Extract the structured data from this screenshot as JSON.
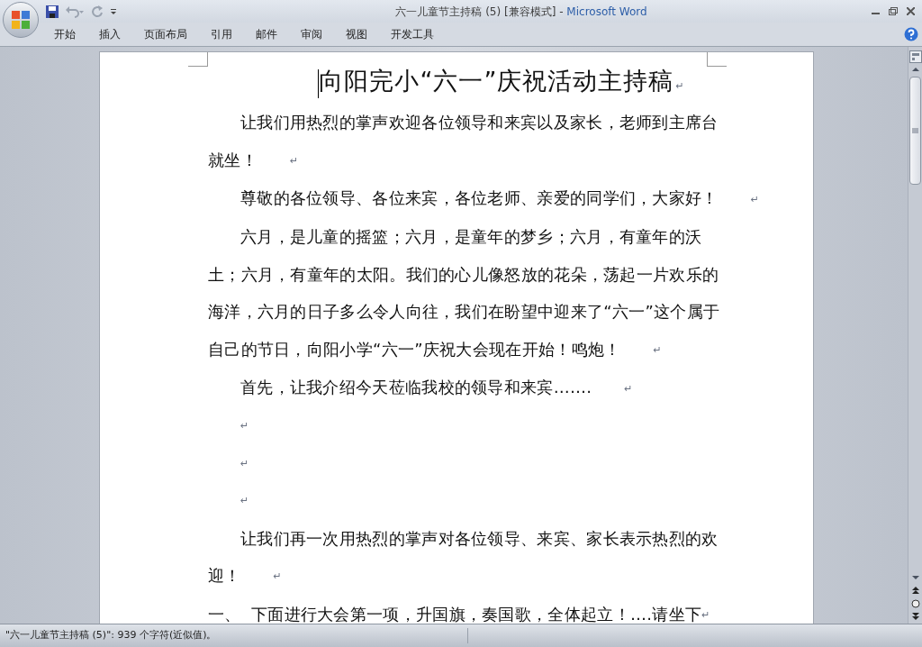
{
  "window": {
    "title": "六一儿童节主持稿 (5) [兼容模式]",
    "separator": " - ",
    "app_name": "Microsoft Word"
  },
  "ribbon_tabs": [
    {
      "label": "开始",
      "selected": false
    },
    {
      "label": "插入",
      "selected": false
    },
    {
      "label": "页面布局",
      "selected": false
    },
    {
      "label": "引用",
      "selected": false
    },
    {
      "label": "邮件",
      "selected": false
    },
    {
      "label": "审阅",
      "selected": false
    },
    {
      "label": "视图",
      "selected": false
    },
    {
      "label": "开发工具",
      "selected": false
    }
  ],
  "document": {
    "title": "向阳完小“六一”庆祝活动主持稿",
    "paragraph_mark": "↵",
    "paragraphs": [
      {
        "kind": "indent",
        "text": "让我们用热烈的掌声欢迎各位领导和来宾以及家长，老师到主席台就坐！"
      },
      {
        "kind": "indent",
        "text": "尊敬的各位领导、各位来宾，各位老师、亲爱的同学们，大家好！"
      },
      {
        "kind": "indent",
        "text": "六月，是儿童的摇篮；六月，是童年的梦乡；六月，有童年的沃土；六月，有童年的太阳。我们的心儿像怒放的花朵，荡起一片欢乐的海洋，六月的日子多么令人向往，我们在盼望中迎来了“六一”这个属于自己的节日，向阳小学“六一”庆祝大会现在开始！鸣炮！"
      },
      {
        "kind": "indent",
        "text": "首先，让我介绍今天莅临我校的领导和来宾……."
      },
      {
        "kind": "empty"
      },
      {
        "kind": "empty"
      },
      {
        "kind": "empty"
      },
      {
        "kind": "indent",
        "text": "让我们再一次用热烈的掌声对各位领导、来宾、家长表示热烈的欢迎！"
      },
      {
        "kind": "numbered",
        "number": "一、",
        "text": "下面进行大会第一项，升国旗，奏国歌，全体起立！….请坐下"
      }
    ]
  },
  "status_bar": {
    "text": "\"六一儿童节主持稿 (5)\": 939 个字符(近似值)。"
  }
}
